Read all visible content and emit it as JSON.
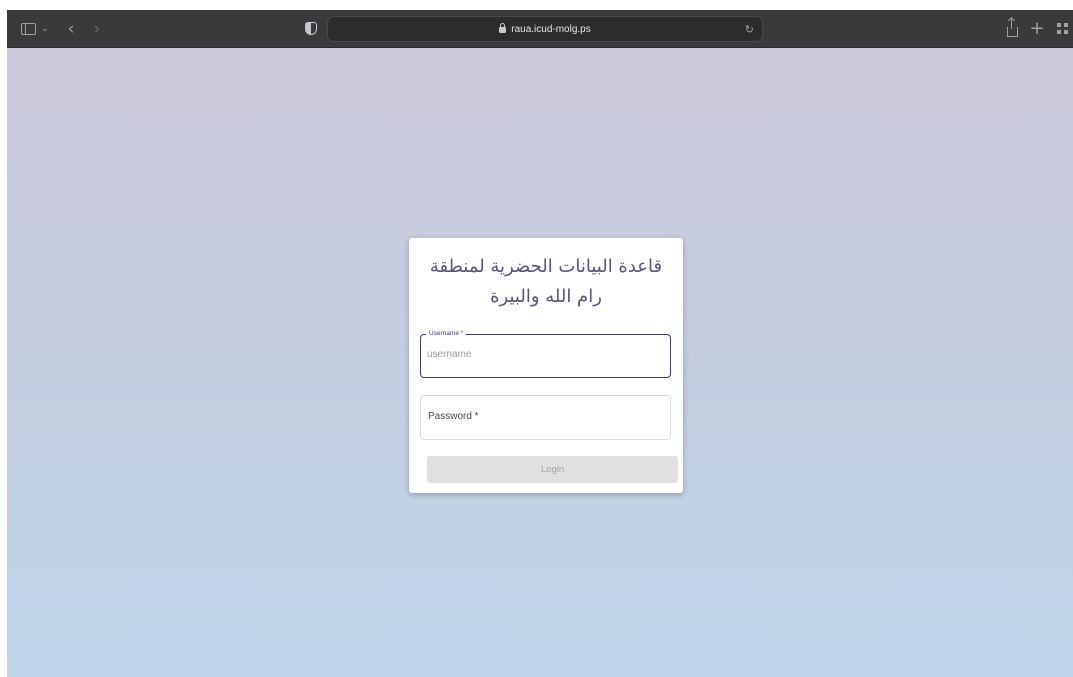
{
  "browser": {
    "url": "raua.icud-molg.ps",
    "icons": [
      "sidebar-icon",
      "chevron-down-icon",
      "back-arrow-icon",
      "forward-arrow-icon",
      "shield-icon",
      "lock-icon",
      "reload-icon",
      "share-icon",
      "plus-icon",
      "tab-overview-icon"
    ]
  },
  "login": {
    "title_line1": "قاعدة البيانات الحضرية لمنطقة",
    "title_line2": "رام الله والبيرة",
    "username_label": "Username *",
    "username_placeholder": "username",
    "password_label": "Password *",
    "login_button": "Login"
  },
  "colors": {
    "title": "#5b5478",
    "active_border": "#3f3f67",
    "button_disabled": "#e0e0e0",
    "background_top": "#cbc9da",
    "background_bottom": "#bfd5ea"
  }
}
